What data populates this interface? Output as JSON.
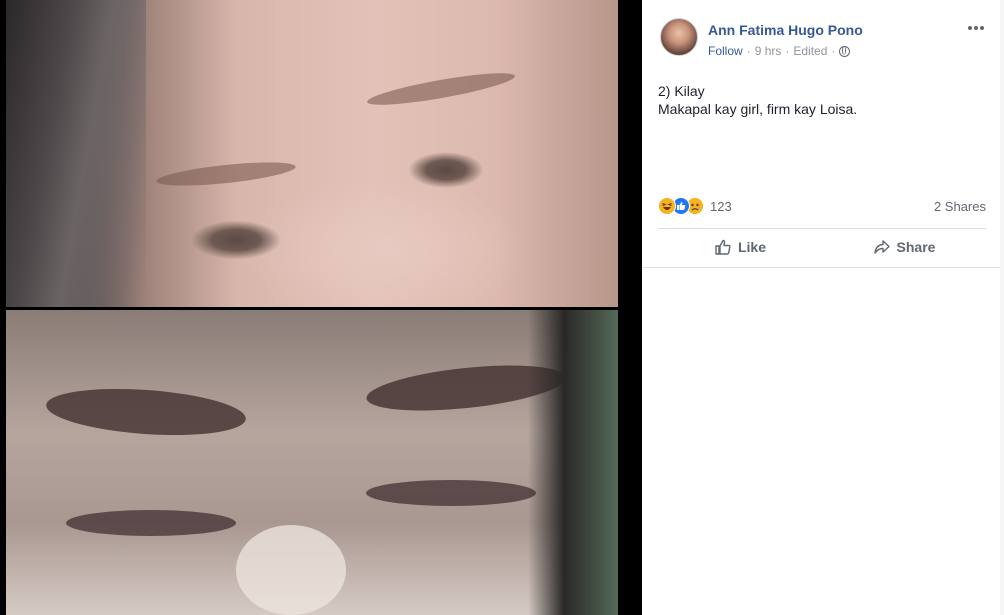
{
  "post": {
    "author": "Ann Fatima Hugo Pono",
    "follow_label": "Follow",
    "separator": "·",
    "time": "9 hrs",
    "edited": "Edited",
    "text_line1": "2) Kilay",
    "text_line2": "Makapal kay girl, firm kay Loisa.",
    "reaction_count": "123",
    "shares": "2 Shares",
    "like_label": "Like",
    "share_label": "Share",
    "privacy_icon": "globe-icon",
    "reactions": [
      "haha",
      "like",
      "sad"
    ]
  }
}
